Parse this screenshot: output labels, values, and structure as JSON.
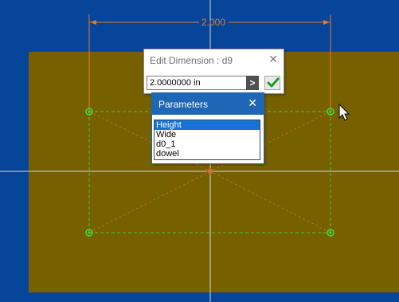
{
  "dimension": {
    "value_label": "2.000"
  },
  "edit_dialog": {
    "title": "Edit Dimension : d9",
    "close_glyph": "✕",
    "value": "2.0000000 in",
    "arrow_glyph": ">"
  },
  "parameters_dialog": {
    "title": "Parameters",
    "close_glyph": "✕",
    "items": [
      "Height",
      "Wide",
      "d0_1",
      "dowel"
    ],
    "selected_index": 0
  },
  "colors": {
    "background": "#07459a",
    "plate": "#776000",
    "dimension_line": "#e07a2a",
    "constraint_point": "#39e23a",
    "accent": "#1f66b6"
  }
}
